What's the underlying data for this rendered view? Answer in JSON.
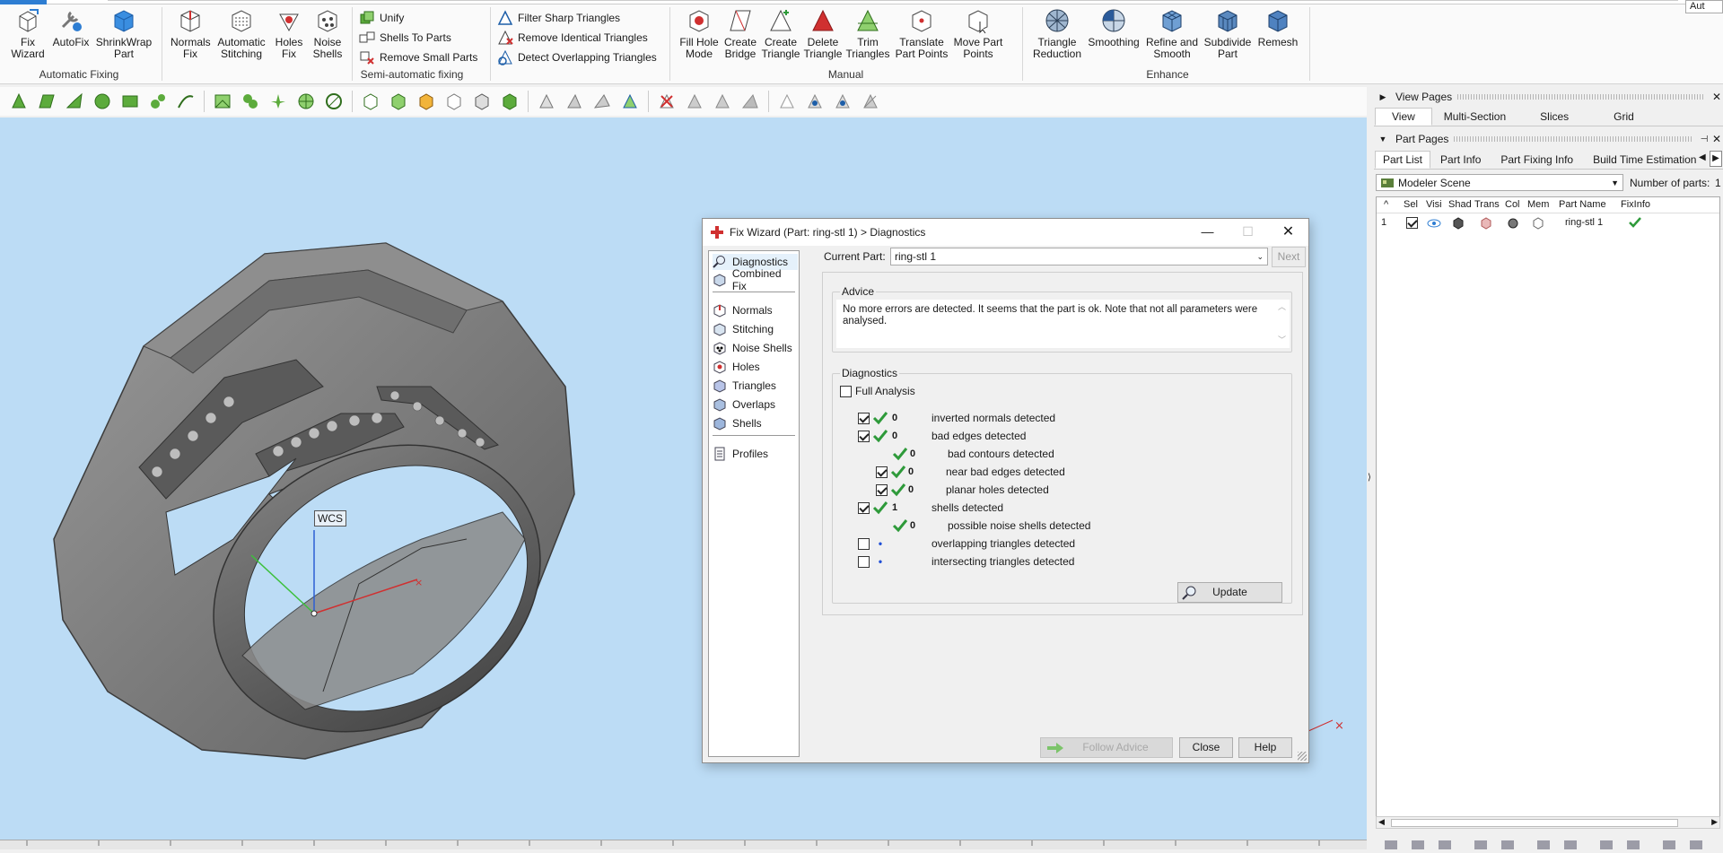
{
  "ribbon": {
    "aut_label": "Aut",
    "groups": {
      "automatic": {
        "label": "Automatic Fixing",
        "buttons": [
          {
            "l1": "Fix",
            "l2": "Wizard"
          },
          {
            "l1": "AutoFix",
            "l2": ""
          },
          {
            "l1": "ShrinkWrap",
            "l2": "Part"
          }
        ]
      },
      "semi": {
        "label": "Semi-automatic fixing",
        "big": [
          {
            "l1": "Normals",
            "l2": "Fix"
          },
          {
            "l1": "Automatic",
            "l2": "Stitching"
          },
          {
            "l1": "Holes",
            "l2": "Fix"
          },
          {
            "l1": "Noise",
            "l2": "Shells"
          }
        ],
        "small": [
          "Unify",
          "Shells To Parts",
          "Remove Small Parts"
        ]
      },
      "manual": {
        "label": "Manual",
        "small": [
          "Filter Sharp Triangles",
          "Remove Identical Triangles",
          "Detect Overlapping Triangles"
        ],
        "big": [
          {
            "l1": "Fill Hole",
            "l2": "Mode"
          },
          {
            "l1": "Create",
            "l2": "Bridge"
          },
          {
            "l1": "Create",
            "l2": "Triangle"
          },
          {
            "l1": "Delete",
            "l2": "Triangle"
          },
          {
            "l1": "Trim",
            "l2": "Triangles"
          },
          {
            "l1": "Translate",
            "l2": "Part Points"
          },
          {
            "l1": "Move Part",
            "l2": "Points"
          }
        ]
      },
      "enhance": {
        "label": "Enhance",
        "buttons": [
          {
            "l1": "Triangle",
            "l2": "Reduction"
          },
          {
            "l1": "Smoothing",
            "l2": ""
          },
          {
            "l1": "Refine and",
            "l2": "Smooth"
          },
          {
            "l1": "Subdivide",
            "l2": "Part"
          },
          {
            "l1": "Remesh",
            "l2": ""
          }
        ]
      }
    }
  },
  "viewport": {
    "wcs_label": "WCS"
  },
  "right_panel": {
    "view_pages": {
      "title": "View Pages",
      "tabs": [
        "View",
        "Multi-Section",
        "Slices",
        "Grid"
      ],
      "selected": 0
    },
    "part_pages": {
      "title": "Part Pages",
      "tabs": [
        "Part List",
        "Part Info",
        "Part Fixing Info",
        "Build Time Estimation"
      ],
      "selected": 0
    },
    "scene_select": "Modeler Scene",
    "parts_count_label": "Number of parts:",
    "parts_count": "1",
    "table": {
      "columns": [
        "^",
        "Sel",
        "Visi",
        "Shad",
        "Trans",
        "Col",
        "Mem",
        "Part Name",
        "FixInfo"
      ],
      "rows": [
        {
          "index": "1",
          "name": "ring-stl 1"
        }
      ]
    }
  },
  "dialog": {
    "title": "Fix Wizard (Part: ring-stl 1) > Diagnostics",
    "nav_top": [
      "Diagnostics",
      "Combined Fix"
    ],
    "nav_mid": [
      "Normals",
      "Stitching",
      "Noise Shells",
      "Holes",
      "Triangles",
      "Overlaps",
      "Shells"
    ],
    "nav_bottom": [
      "Profiles"
    ],
    "current_part_label": "Current Part:",
    "current_part_value": "ring-stl 1",
    "next_label": "Next",
    "advice_title": "Advice",
    "advice_text": "No more errors are detected. It seems that the part is ok. Note that not all parameters were analysed.",
    "diagnostics_title": "Diagnostics",
    "full_analysis_label": "Full Analysis",
    "rows": [
      {
        "num": "0",
        "text": "inverted normals detected"
      },
      {
        "num": "0",
        "text": "bad edges detected"
      },
      {
        "num": "0",
        "text": "bad contours detected"
      },
      {
        "num": "0",
        "text": "near bad edges detected"
      },
      {
        "num": "0",
        "text": "planar holes detected"
      },
      {
        "num": "1",
        "text": "shells detected"
      },
      {
        "num": "0",
        "text": "possible noise shells detected"
      },
      {
        "num": "",
        "text": "overlapping triangles detected"
      },
      {
        "num": "",
        "text": "intersecting triangles detected"
      }
    ],
    "update_label": "Update",
    "follow_advice_label": "Follow Advice",
    "close_label": "Close",
    "help_label": "Help"
  },
  "colors": {
    "viewport_bg": "#bcdcf5",
    "accent": "#2d7dd2",
    "ok_green": "#2e9a3a",
    "ribbon_red": "#d03030"
  }
}
